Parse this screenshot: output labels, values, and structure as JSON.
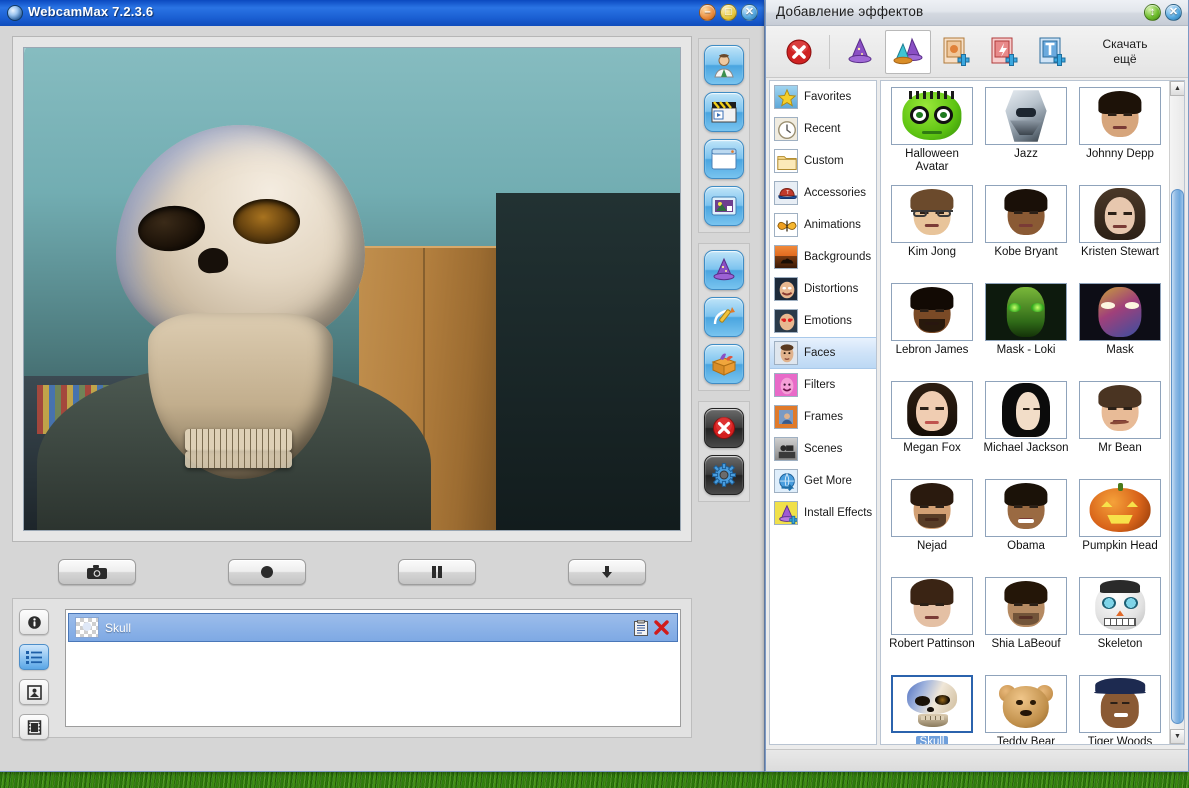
{
  "desktop": {
    "background": "#3f9413"
  },
  "main_window": {
    "title": "WebcamMax  7.2.3.6",
    "icon": "webcam-lens-icon",
    "buttons": {
      "minimize": "–",
      "maximize": "□",
      "close": "✕"
    },
    "media_controls": [
      {
        "name": "snapshot-button",
        "icon": "camera-icon"
      },
      {
        "name": "record-button",
        "icon": "record-circle-icon"
      },
      {
        "name": "pause-button",
        "icon": "pause-icon"
      },
      {
        "name": "download-button",
        "icon": "down-arrow-icon"
      }
    ],
    "side_toolbar": {
      "group1": [
        {
          "name": "avatar-button",
          "icon": "person-icon"
        },
        {
          "name": "video-button",
          "icon": "clapperboard-icon"
        },
        {
          "name": "window-button",
          "icon": "window-icon"
        },
        {
          "name": "media-button",
          "icon": "picture-frame-icon"
        }
      ],
      "group2": [
        {
          "name": "effects-button",
          "icon": "wizard-hat-icon"
        },
        {
          "name": "doodle-button",
          "icon": "magic-wand-icon"
        },
        {
          "name": "package-button",
          "icon": "effects-box-icon"
        }
      ],
      "group3": [
        {
          "name": "off-button",
          "icon": "red-x-icon"
        },
        {
          "name": "settings-button",
          "icon": "gear-icon"
        }
      ]
    },
    "effects_list": {
      "side_buttons": [
        {
          "name": "info-button",
          "icon": "info-icon",
          "active": false
        },
        {
          "name": "list-view-button",
          "icon": "list-icon",
          "active": true
        },
        {
          "name": "image-view-button",
          "icon": "image-icon",
          "active": false
        },
        {
          "name": "film-view-button",
          "icon": "film-icon",
          "active": false
        }
      ],
      "rows": [
        {
          "label": "Skull",
          "thumb": "skull-thumb",
          "selected": true,
          "actions": [
            {
              "name": "properties-icon",
              "glyph": "clipboard"
            },
            {
              "name": "remove-icon",
              "glyph": "red-x"
            }
          ]
        }
      ]
    }
  },
  "effects_window": {
    "title": "Добавление эффектов",
    "buttons": {
      "restore": "↕",
      "close": "✕"
    },
    "toolbar": {
      "items": [
        {
          "name": "clear-effects-button",
          "icon": "red-x-circle-icon",
          "selected": false
        },
        {
          "name": "single-effect-button",
          "icon": "purple-hat-icon",
          "selected": false
        },
        {
          "name": "multi-effect-button",
          "icon": "multi-hat-icon",
          "selected": true
        },
        {
          "name": "add-picture-button",
          "icon": "add-image-icon",
          "selected": false
        },
        {
          "name": "add-flash-button",
          "icon": "add-flash-icon",
          "selected": false
        },
        {
          "name": "add-text-button",
          "icon": "add-text-icon",
          "selected": false
        }
      ],
      "download_more": "Скачать\nещё",
      "download_more_line1": "Скачать",
      "download_more_line2": "ещё"
    },
    "categories": [
      {
        "label": "Favorites",
        "icon": "star-icon",
        "selected": false
      },
      {
        "label": "Recent",
        "icon": "clock-icon",
        "selected": false
      },
      {
        "label": "Custom",
        "icon": "folder-icon",
        "selected": false
      },
      {
        "label": "Accessories",
        "icon": "cap-icon",
        "selected": false
      },
      {
        "label": "Animations",
        "icon": "butterfly-icon",
        "selected": false
      },
      {
        "label": "Backgrounds",
        "icon": "desert-icon",
        "selected": false
      },
      {
        "label": "Distortions",
        "icon": "distorted-face-icon",
        "selected": false
      },
      {
        "label": "Emotions",
        "icon": "emotion-face-icon",
        "selected": false
      },
      {
        "label": "Faces",
        "icon": "face-icon",
        "selected": true
      },
      {
        "label": "Filters",
        "icon": "filter-face-icon",
        "selected": false
      },
      {
        "label": "Frames",
        "icon": "frame-icon",
        "selected": false
      },
      {
        "label": "Scenes",
        "icon": "scene-icon",
        "selected": false
      },
      {
        "label": "Get More",
        "icon": "globe-icon",
        "selected": false
      },
      {
        "label": "Install Effects",
        "icon": "install-hat-icon",
        "selected": false
      }
    ],
    "effects": [
      {
        "label": "Halloween Avatar",
        "thumb": "green-monster",
        "selected": false
      },
      {
        "label": "Jazz",
        "thumb": "robot-helmet",
        "selected": false
      },
      {
        "label": "Johnny Depp",
        "thumb": "male-dark-hair",
        "selected": false
      },
      {
        "label": "Kim Jong",
        "thumb": "male-glasses",
        "selected": false
      },
      {
        "label": "Kobe Bryant",
        "thumb": "male-dark-skin",
        "selected": false
      },
      {
        "label": "Kristen Stewart",
        "thumb": "female-brown-hair",
        "selected": false
      },
      {
        "label": "Lebron James",
        "thumb": "male-beard",
        "selected": false
      },
      {
        "label": "Mask - Loki",
        "thumb": "green-mask",
        "selected": false
      },
      {
        "label": "Mask",
        "thumb": "venetian-mask",
        "selected": false
      },
      {
        "label": "Megan Fox",
        "thumb": "female-dark-hair",
        "selected": false
      },
      {
        "label": "Michael Jackson",
        "thumb": "mj-face",
        "selected": false
      },
      {
        "label": "Mr Bean",
        "thumb": "mrbean-face",
        "selected": false
      },
      {
        "label": "Nejad",
        "thumb": "male-short-beard",
        "selected": false
      },
      {
        "label": "Obama",
        "thumb": "obama-face",
        "selected": false
      },
      {
        "label": "Pumpkin Head",
        "thumb": "pumpkin",
        "selected": false
      },
      {
        "label": "Robert Pattinson",
        "thumb": "male-messy-hair",
        "selected": false
      },
      {
        "label": "Shia LaBeouf",
        "thumb": "male-stubble",
        "selected": false
      },
      {
        "label": "Skeleton",
        "thumb": "cartoon-skeleton",
        "selected": false
      },
      {
        "label": "Skull",
        "thumb": "blue-skull",
        "selected": true
      },
      {
        "label": "Teddy Bear",
        "thumb": "teddy-bear",
        "selected": false
      },
      {
        "label": "Tiger Woods",
        "thumb": "male-cap",
        "selected": false
      }
    ],
    "scrollbar": {
      "up": "▲",
      "down": "▼"
    }
  },
  "colors": {
    "titlebar_blue": "#1b62d6",
    "selection_blue": "#7ea9e4",
    "accent_blue": "#2b63ad",
    "panel_gray": "#d6d6d6"
  }
}
